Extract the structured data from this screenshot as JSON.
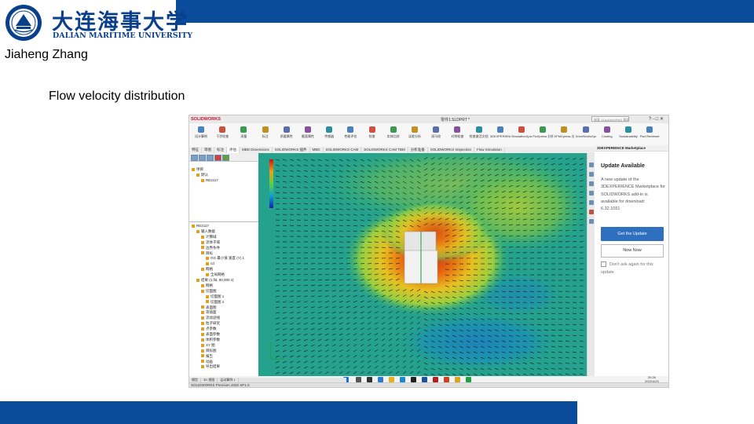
{
  "slide": {
    "university_cn": "大连海事大学",
    "university_en": "DALIAN MARITIME UNIVERSITY",
    "author": "Jiaheng Zhang",
    "title": "Flow velocity distribution"
  },
  "colors": {
    "brand_blue": "#0a4b9c",
    "button_blue": "#2f6fc0"
  },
  "app": {
    "logo_text": "SOLIDWORKS",
    "file_title": "零件1.SLDPRT *",
    "search_placeholder": "搜索 SOLIDWORKS 帮助",
    "window_controls": "? -  □ ✕",
    "toolbar_items": [
      {
        "label": "设计算例",
        "icon": "design-study-icon"
      },
      {
        "label": "干涉检查",
        "icon": "interference-icon"
      },
      {
        "label": "测量",
        "icon": "measure-icon"
      },
      {
        "label": "标注",
        "icon": "markup-icon"
      },
      {
        "label": "质量属性",
        "icon": "mass-properties-icon"
      },
      {
        "label": "截面属性",
        "icon": "section-properties-icon"
      },
      {
        "label": "传感器",
        "icon": "sensor-icon"
      },
      {
        "label": "性能评估",
        "icon": "performance-icon"
      },
      {
        "label": "检查",
        "icon": "check-icon"
      },
      {
        "label": "实体比较",
        "icon": "compare-icon"
      },
      {
        "label": "误差分析",
        "icon": "deviation-icon"
      },
      {
        "label": "斑马纹",
        "icon": "zebra-icon"
      },
      {
        "label": "对称检查",
        "icon": "symmetry-icon"
      },
      {
        "label": "检查激活文档",
        "icon": "check-active-icon"
      },
      {
        "label": "3DEXPERIENCE Simulation Connector",
        "icon": "3dx-sim-icon"
      },
      {
        "label": "SimulationXpress 分析向导",
        "icon": "simxpress-icon"
      },
      {
        "label": "FloXpress 分析向导",
        "icon": "floxpress-icon"
      },
      {
        "label": "DFMXpress 分析向导",
        "icon": "dfmxpress-icon"
      },
      {
        "label": "DriveWorksXpress 向导",
        "icon": "driveworks-icon"
      },
      {
        "label": "Costing",
        "icon": "costing-icon"
      },
      {
        "label": "Sustainability",
        "icon": "sustainability-icon"
      },
      {
        "label": "Part Reviewer",
        "icon": "part-reviewer-icon"
      }
    ],
    "command_tabs": [
      "特征",
      "草图",
      "标注",
      "评估",
      "MBD Dimensions",
      "SOLIDWORKS 插件",
      "MBD",
      "SOLIDWORKS CAM",
      "SOLIDWORKS CAM TBM",
      "分析准备",
      "SOLIDWORKS Inspection",
      "Flow Simulation"
    ],
    "active_tab_index": 3,
    "tree_top": [
      {
        "label": "项目",
        "indent": 0
      },
      {
        "label": "默认",
        "indent": 1
      },
      {
        "label": "RE2117",
        "indent": 2
      }
    ],
    "tree_bottom": [
      {
        "label": "RE2117",
        "indent": 0
      },
      {
        "label": "输入数据",
        "indent": 1
      },
      {
        "label": "计算域",
        "indent": 2
      },
      {
        "label": "流体子域",
        "indent": 2
      },
      {
        "label": "边界条件",
        "indent": 2
      },
      {
        "label": "目标",
        "indent": 2
      },
      {
        "label": "GG 最小值 速度 (Y) 1",
        "indent": 3
      },
      {
        "label": "cd",
        "indent": 3
      },
      {
        "label": "网格",
        "indent": 2
      },
      {
        "label": "全局网格",
        "indent": 3
      },
      {
        "label": "结果 (1.fld, 80,000 s)",
        "indent": 1
      },
      {
        "label": "网格",
        "indent": 2
      },
      {
        "label": "切面图",
        "indent": 2
      },
      {
        "label": "切面图 1",
        "indent": 3
      },
      {
        "label": "切面图 2",
        "indent": 3
      },
      {
        "label": "表面图",
        "indent": 2
      },
      {
        "label": "等值面",
        "indent": 2
      },
      {
        "label": "流动迹线",
        "indent": 2
      },
      {
        "label": "粒子研究",
        "indent": 2
      },
      {
        "label": "点参数",
        "indent": 2
      },
      {
        "label": "表面参数",
        "indent": 2
      },
      {
        "label": "体积参数",
        "indent": 2
      },
      {
        "label": "XY 图",
        "indent": 2
      },
      {
        "label": "目标图",
        "indent": 2
      },
      {
        "label": "报告",
        "indent": 2
      },
      {
        "label": "动画",
        "indent": 2
      },
      {
        "label": "导出结果",
        "indent": 2
      }
    ],
    "panel_header": "3DEXPERIENCE Marketplace",
    "update": {
      "title": "Update Available",
      "body": "A new update of the 3DEXPERIENCE Marketplace for SOLIDWORKS add-in is available for download: 6.32.1051",
      "get_button": "Get the Update",
      "not_now_button": "Now Now",
      "dont_ask": "Don't ask again for this update"
    },
    "bottom_tabs": [
      "模型",
      "3D 视图",
      "运动算例 1"
    ],
    "status_text": "SOLIDWORKS Premium 2020 SP1.0",
    "clock_time": "20:26",
    "clock_date": "2022/4/20"
  }
}
